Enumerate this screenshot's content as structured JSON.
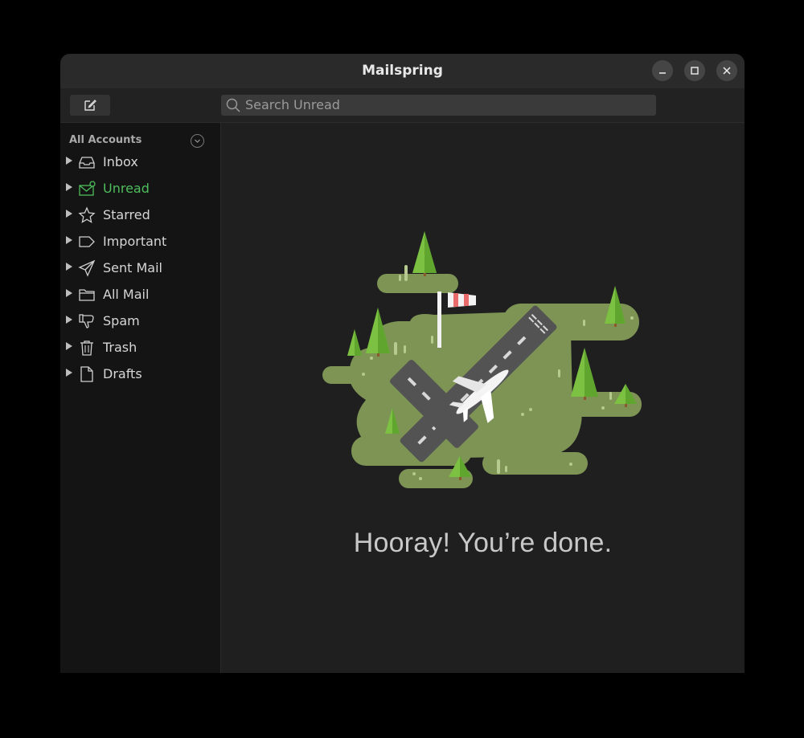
{
  "window": {
    "title": "Mailspring"
  },
  "toolbar": {
    "search_placeholder": "Search Unread"
  },
  "sidebar": {
    "account_label": "All Accounts",
    "items": [
      {
        "label": "Inbox",
        "icon": "inbox-icon",
        "active": false
      },
      {
        "label": "Unread",
        "icon": "unread-icon",
        "active": true
      },
      {
        "label": "Starred",
        "icon": "star-icon",
        "active": false
      },
      {
        "label": "Important",
        "icon": "important-label-icon",
        "active": false
      },
      {
        "label": "Sent Mail",
        "icon": "send-icon",
        "active": false
      },
      {
        "label": "All Mail",
        "icon": "folder-icon",
        "active": false
      },
      {
        "label": "Spam",
        "icon": "thumbs-down-icon",
        "active": false
      },
      {
        "label": "Trash",
        "icon": "trash-icon",
        "active": false
      },
      {
        "label": "Drafts",
        "icon": "draft-icon",
        "active": false
      }
    ]
  },
  "main": {
    "empty_message": "Hooray! You’re done."
  },
  "colors": {
    "accent": "#4ebd5c",
    "grass": "#7d9454",
    "runway": "#535353",
    "tree": "#7cc142"
  }
}
